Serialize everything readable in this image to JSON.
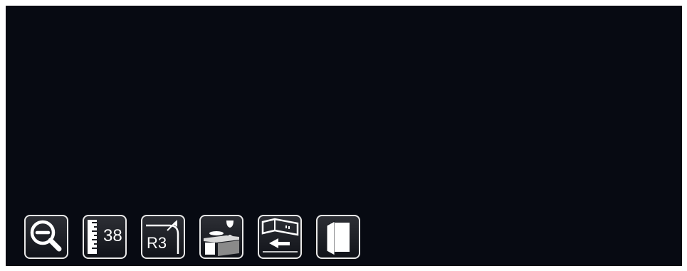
{
  "toolbar": {
    "tools": [
      {
        "icon": "zoom-out-icon"
      },
      {
        "icon": "ruler-size-icon",
        "label": "38"
      },
      {
        "icon": "corner-radius-icon",
        "label": "R3"
      },
      {
        "icon": "worktop-icon"
      },
      {
        "icon": "wall-cabinet-icon"
      },
      {
        "icon": "cabinet-door-icon"
      }
    ]
  }
}
